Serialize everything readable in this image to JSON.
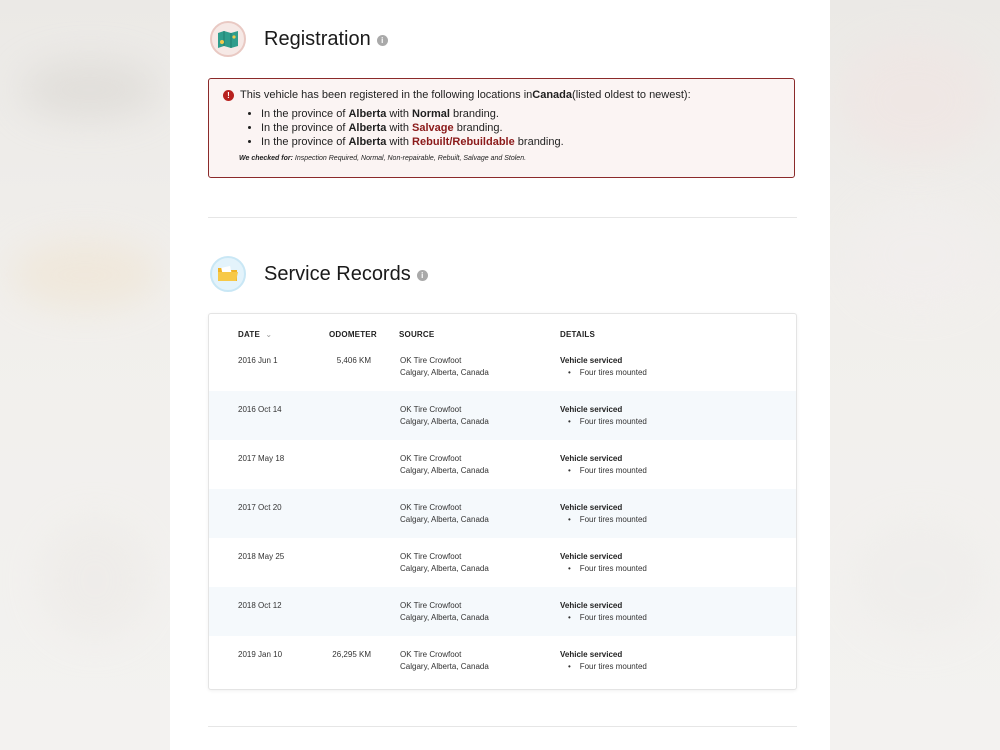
{
  "registration": {
    "title": "Registration",
    "info": "i",
    "alert": {
      "icon": "!",
      "intro_1": "This vehicle has been registered in the following locations in ",
      "intro_country": "Canada",
      "intro_2": " (listed oldest to newest):",
      "items": [
        {
          "prefix": "In the province of ",
          "province": "Alberta",
          "mid": " with ",
          "brand": "Normal",
          "suffix": " branding.",
          "brand_color": "#111111"
        },
        {
          "prefix": "In the province of ",
          "province": "Alberta",
          "mid": " with ",
          "brand": "Salvage",
          "suffix": " branding.",
          "brand_color": "#8b1a1a"
        },
        {
          "prefix": "In the province of ",
          "province": "Alberta",
          "mid": " with ",
          "brand": "Rebuilt/Rebuildable",
          "suffix": " branding.",
          "brand_color": "#8b1a1a"
        }
      ],
      "checked_label": "We checked for:",
      "checked_list": " Inspection Required, Normal, Non-repairable, Rebuilt, Salvage and Stolen."
    }
  },
  "service": {
    "title": "Service Records",
    "info": "i",
    "columns": {
      "date": "DATE",
      "sort_icon": "⌄",
      "odometer": "ODOMETER",
      "source": "SOURCE",
      "details": "DETAILS"
    },
    "rows": [
      {
        "date": "2016 Jun 1",
        "odometer": "5,406 KM",
        "source_name": "OK Tire Crowfoot",
        "source_loc": "Calgary, Alberta, Canada",
        "detail_title": "Vehicle serviced",
        "detail_item": "Four tires mounted"
      },
      {
        "date": "2016 Oct 14",
        "odometer": "",
        "source_name": "OK Tire Crowfoot",
        "source_loc": "Calgary, Alberta, Canada",
        "detail_title": "Vehicle serviced",
        "detail_item": "Four tires mounted"
      },
      {
        "date": "2017 May 18",
        "odometer": "",
        "source_name": "OK Tire Crowfoot",
        "source_loc": "Calgary, Alberta, Canada",
        "detail_title": "Vehicle serviced",
        "detail_item": "Four tires mounted"
      },
      {
        "date": "2017 Oct 20",
        "odometer": "",
        "source_name": "OK Tire Crowfoot",
        "source_loc": "Calgary, Alberta, Canada",
        "detail_title": "Vehicle serviced",
        "detail_item": "Four tires mounted"
      },
      {
        "date": "2018 May 25",
        "odometer": "",
        "source_name": "OK Tire Crowfoot",
        "source_loc": "Calgary, Alberta, Canada",
        "detail_title": "Vehicle serviced",
        "detail_item": "Four tires mounted"
      },
      {
        "date": "2018 Oct 12",
        "odometer": "",
        "source_name": "OK Tire Crowfoot",
        "source_loc": "Calgary, Alberta, Canada",
        "detail_title": "Vehicle serviced",
        "detail_item": "Four tires mounted"
      },
      {
        "date": "2019 Jan 10",
        "odometer": "26,295 KM",
        "source_name": "OK Tire Crowfoot",
        "source_loc": "Calgary, Alberta, Canada",
        "detail_title": "Vehicle serviced",
        "detail_item": "Four tires mounted"
      }
    ]
  },
  "icons": {
    "registration": "map-icon",
    "service": "folder-icon"
  },
  "colors": {
    "alert_border": "#8b2a2a",
    "alert_bg": "#fbf4f3",
    "brand_red": "#8b1a1a",
    "row_alt": "#f5f9fc"
  }
}
